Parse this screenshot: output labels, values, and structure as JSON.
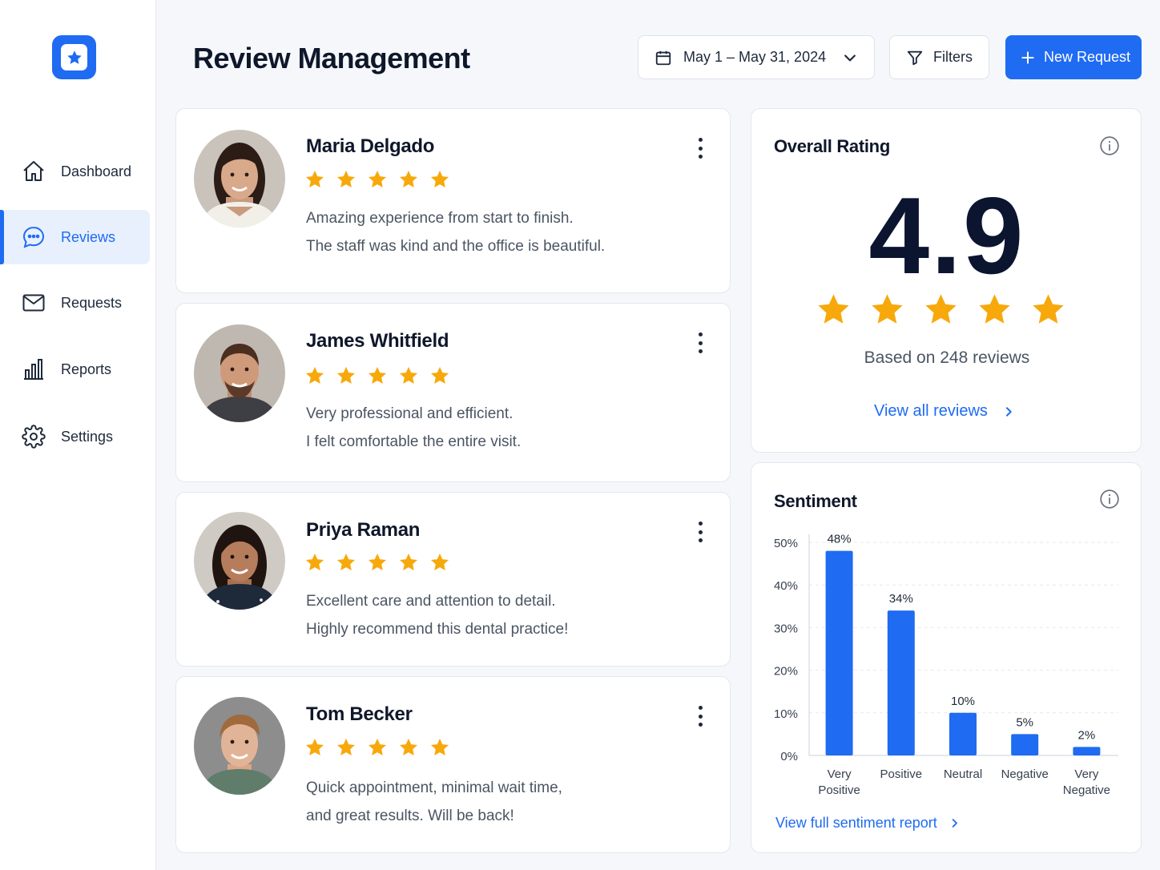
{
  "colors": {
    "accent": "#1f6bf2",
    "star": "#f7a90b",
    "text_dark": "#0f172a",
    "text_muted": "#4b5563"
  },
  "sidebar": {
    "logo_icon": "star-badge-icon",
    "items": [
      {
        "label": "Dashboard",
        "icon": "home-icon",
        "active": false
      },
      {
        "label": "Reviews",
        "icon": "chat-bubble-icon",
        "active": true
      },
      {
        "label": "Requests",
        "icon": "envelope-icon",
        "active": false
      },
      {
        "label": "Reports",
        "icon": "bar-chart-icon",
        "active": false
      },
      {
        "label": "Settings",
        "icon": "gear-icon",
        "active": false
      }
    ]
  },
  "header": {
    "title": "Review Management",
    "date_range": "May 1 – May 31, 2024",
    "filters_label": "Filters",
    "new_request_label": "New Request"
  },
  "reviews": [
    {
      "name": "Maria Delgado",
      "rating": 5,
      "line1": "Amazing experience from start to finish.",
      "line2": "The staff was kind and the office is beautiful."
    },
    {
      "name": "James Whitfield",
      "rating": 5,
      "line1": "Very professional and efficient.",
      "line2": "I felt comfortable the entire visit."
    },
    {
      "name": "Priya Raman",
      "rating": 5,
      "line1": "Excellent care and attention to detail.",
      "line2": "Highly recommend this dental practice!"
    },
    {
      "name": "Tom Becker",
      "rating": 5,
      "line1": "Quick appointment, minimal wait time,",
      "line2": "and great results. Will be back!"
    }
  ],
  "overall": {
    "title": "Overall Rating",
    "rating": "4.9",
    "stars": 5,
    "based_on": "Based on 248 reviews",
    "view_all": "View all reviews"
  },
  "sentiment": {
    "title": "Sentiment",
    "link": "View full sentiment report"
  },
  "chart_data": {
    "type": "bar",
    "title": "Sentiment",
    "categories": [
      [
        "Very",
        "Positive"
      ],
      [
        "Positive"
      ],
      [
        "Neutral"
      ],
      [
        "Negative"
      ],
      [
        "Very",
        "Negative"
      ]
    ],
    "values": [
      48,
      34,
      10,
      5,
      2
    ],
    "value_labels": [
      "48%",
      "34%",
      "10%",
      "5%",
      "2%"
    ],
    "ylim": [
      0,
      50
    ],
    "yticks": [
      "0%",
      "10%",
      "20%",
      "30%",
      "40%",
      "50%"
    ],
    "grid": true,
    "color": "#1f6bf2"
  }
}
